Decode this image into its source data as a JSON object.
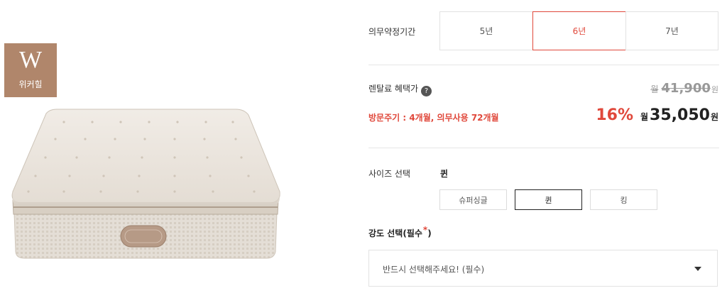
{
  "brand": {
    "logo_letter": "W",
    "name": "위커힐",
    "color": "#b0866b"
  },
  "product_image": {
    "icon": "mattress-image"
  },
  "period": {
    "label": "의무약정기간",
    "options": [
      {
        "label": "5년",
        "selected": false
      },
      {
        "label": "6년",
        "selected": true
      },
      {
        "label": "7년",
        "selected": false
      }
    ]
  },
  "pricing": {
    "label": "렌탈료 혜택가",
    "help_icon": "question-icon",
    "help_glyph": "?",
    "original": {
      "prefix": "월",
      "amount": "41,900",
      "unit": "원"
    },
    "visit_info": "방문주기 : 4개월, 의무사용 72개월",
    "discount": "16%",
    "final": {
      "prefix": "월",
      "amount": "35,050",
      "unit": "원"
    },
    "accent_color": "#e0483b"
  },
  "size": {
    "label": "사이즈 선택",
    "selected_value": "퀸",
    "options": [
      {
        "label": "슈퍼싱글",
        "selected": false
      },
      {
        "label": "퀸",
        "selected": true
      },
      {
        "label": "킹",
        "selected": false
      }
    ]
  },
  "strength": {
    "label": "강도 선택(필수",
    "required_mark": "*",
    "label_suffix": ")",
    "select_placeholder": "반드시 선택해주세요! (필수)",
    "caret_icon": "caret-down-icon"
  }
}
